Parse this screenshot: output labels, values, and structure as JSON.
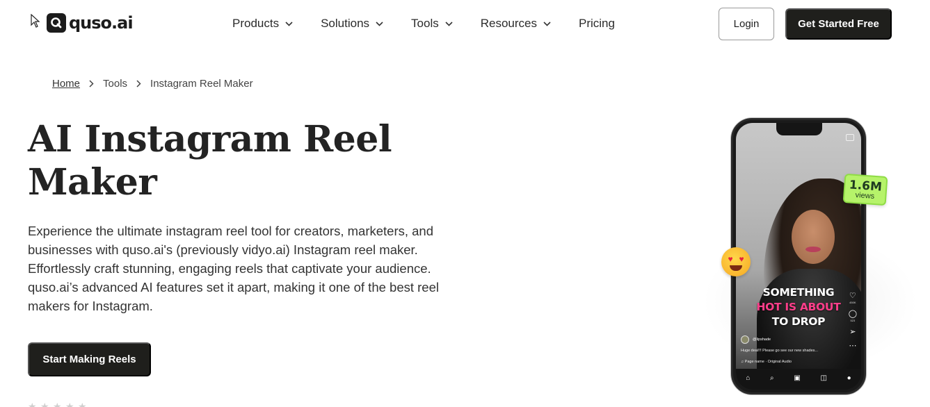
{
  "header": {
    "logo_text": "quso.ai",
    "nav": [
      {
        "label": "Products",
        "has_dropdown": true
      },
      {
        "label": "Solutions",
        "has_dropdown": true
      },
      {
        "label": "Tools",
        "has_dropdown": true
      },
      {
        "label": "Resources",
        "has_dropdown": true
      },
      {
        "label": "Pricing",
        "has_dropdown": false
      }
    ],
    "login_label": "Login",
    "cta_label": "Get Started Free"
  },
  "breadcrumb": {
    "home": "Home",
    "tools": "Tools",
    "current": "Instagram Reel Maker"
  },
  "hero": {
    "title": "AI Instagram Reel Maker",
    "description": "Experience the ultimate instagram reel tool for creators, marketers, and businesses with quso.ai's (previously vidyo.ai) Instagram reel maker. Effortlessly craft stunning, engaging reels that captivate your audience. quso.ai’s advanced AI features set it apart, making it one of the best reel makers for Instagram.",
    "cta_label": "Start Making Reels",
    "stars": 5
  },
  "phone": {
    "caption_line1": "SOMETHING",
    "caption_line2": "HOT IS ABOUT",
    "caption_line3": "TO DROP",
    "username": "@lipshade",
    "post_text": "Huge deal!!! Please go see our new shades...",
    "audio": "Page name · Original Audio",
    "likes": "450K",
    "comments": "523",
    "views_number": "1.6M",
    "views_label": "views"
  },
  "colors": {
    "primary_dark": "#1f1f1c",
    "views_badge": "#b6f36a",
    "caption_pink": "#ff3e8a"
  }
}
